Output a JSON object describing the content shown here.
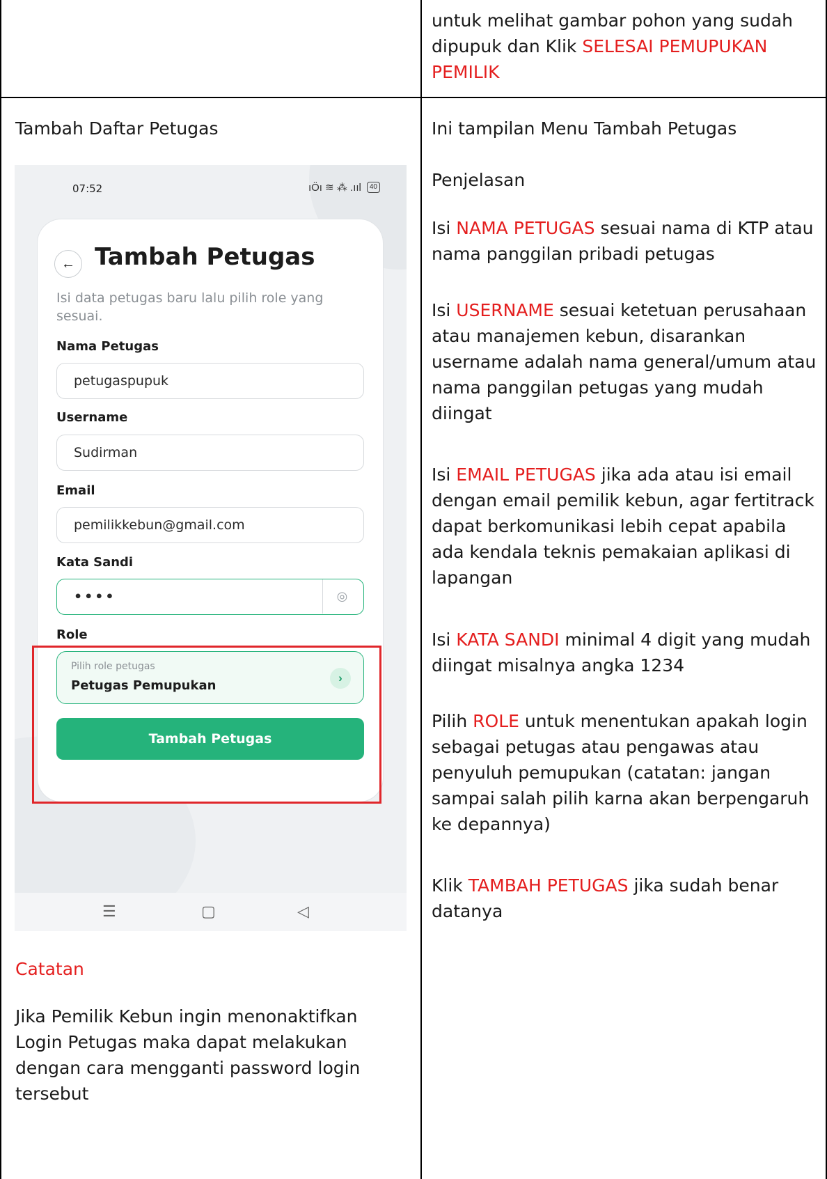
{
  "top_row": {
    "right_text_a": "untuk melihat gambar pohon yang sudah dipupuk dan Klik ",
    "right_text_red": "SELESAI PEMUPUKAN PEMILIK"
  },
  "left": {
    "title": "Tambah Daftar Petugas",
    "note_title": "Catatan",
    "note_text": "Jika Pemilik Kebun ingin menonaktifkan Login Petugas maka dapat melakukan dengan cara mengganti password login tersebut"
  },
  "phone": {
    "time": "07:52",
    "status_icons": "ıÖı ≋ ⁂ .ııl",
    "battery": "40",
    "title": "Tambah Petugas",
    "subtitle": "Isi data petugas baru lalu pilih role yang sesuai.",
    "fields": {
      "nama_label": "Nama Petugas",
      "nama_value": "petugaspupuk",
      "username_label": "Username",
      "username_value": "Sudirman",
      "email_label": "Email",
      "email_value": "pemilikkebun@gmail.com",
      "password_label": "Kata Sandi",
      "password_value": "••••",
      "role_label": "Role",
      "role_placeholder": "Pilih role petugas",
      "role_value": "Petugas Pemupukan"
    },
    "submit": "Tambah Petugas"
  },
  "right": {
    "intro": "Ini tampilan Menu Tambah Petugas",
    "heading": "Penjelasan",
    "p1": {
      "pre": "Isi ",
      "red": "NAMA PETUGAS",
      "post": " sesuai nama di KTP atau nama panggilan pribadi petugas"
    },
    "p2": {
      "pre": "Isi ",
      "red": "USERNAME",
      "post": " sesuai ketetuan perusahaan atau manajemen kebun, disarankan username adalah nama general/umum atau nama panggilan petugas yang mudah diingat"
    },
    "p3": {
      "pre": "Isi ",
      "red": "EMAIL PETUGAS",
      "post": " jika ada atau isi email dengan email pemilik kebun, agar fertitrack dapat berkomunikasi lebih cepat apabila ada kendala teknis pemakaian aplikasi di lapangan"
    },
    "p4": {
      "pre": "Isi ",
      "red": "KATA SANDI",
      "post": " minimal 4 digit yang mudah diingat misalnya angka 1234"
    },
    "p5": {
      "pre": "Pilih ",
      "red": "ROLE",
      "post": " untuk menentukan apakah login sebagai petugas atau pengawas atau penyuluh pemupukan (catatan: jangan sampai salah pilih karna akan berpengaruh ke depannya)"
    },
    "p6": {
      "pre": "Klik ",
      "red": "TAMBAH PETUGAS",
      "post": " jika sudah benar datanya"
    }
  },
  "colors": {
    "accent_red": "#e41e1e",
    "app_green": "#25b37b",
    "highlight_red": "#e0262a"
  }
}
